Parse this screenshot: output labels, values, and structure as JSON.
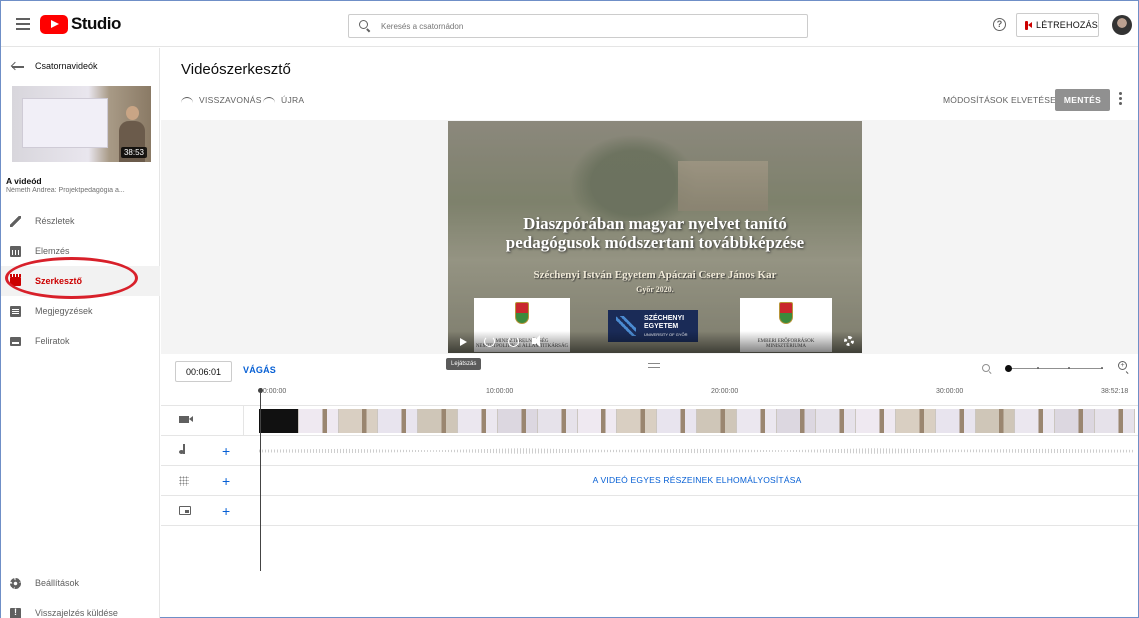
{
  "header": {
    "logo_text": "Studio",
    "search_placeholder": "Keresés a csatornádon",
    "help_icon": "?",
    "create_label": "LÉTREHOZÁS"
  },
  "sidebar": {
    "back_label": "Csatornavideók",
    "thumbnail_duration": "38:53",
    "your_video_label": "A videód",
    "video_subtitle": "Németh Andrea: Projektpedagógia a...",
    "items": [
      {
        "label": "Részletek",
        "icon": "pencil-icon"
      },
      {
        "label": "Elemzés",
        "icon": "analytics-icon"
      },
      {
        "label": "Szerkesztő",
        "icon": "editor-icon"
      },
      {
        "label": "Megjegyzések",
        "icon": "comments-icon"
      },
      {
        "label": "Feliratok",
        "icon": "subtitles-icon"
      }
    ],
    "bottom_items": [
      {
        "label": "Beállítások",
        "icon": "settings-icon"
      },
      {
        "label": "Visszajelzés küldése",
        "icon": "feedback-icon"
      }
    ],
    "active_index": 2
  },
  "editor": {
    "title": "Videószerkesztő",
    "undo_label": "VISSZAVONÁS",
    "redo_label": "ÚJRA",
    "discard_label": "MÓDOSÍTÁSOK ELVETÉSE",
    "save_label": "MENTÉS"
  },
  "video": {
    "title_line1": "Diaszpórában magyar nyelvet tanító",
    "title_line2": "pedagógusok módszertani továbbképzése",
    "subtitle": "Széchenyi István Egyetem Apáczai Csere János Kar",
    "year": "Győr 2020.",
    "left_badge": "MINISZTERELNÖKSÉG NEMZETPOLITIKAI ÁLLAMTITKÁRSÁG",
    "center_badge_line1": "SZÉCHENYI",
    "center_badge_line2": "EGYETEM",
    "center_badge_line3": "UNIVERSITY OF GYŐR",
    "right_badge": "EMBERI ERŐFORRÁSOK MINISZTÉRIUMA",
    "tooltip": "Lejátszás"
  },
  "timeline": {
    "timecode": "00:06:01",
    "cut_label": "VÁGÁS",
    "ticks": [
      "00:00:00",
      "10:00:00",
      "20:00:00",
      "30:00:00",
      "38:52:18"
    ],
    "blur_label": "A VIDEÓ EGYES RÉSZEINEK ELHOMÁLYOSÍTÁSA",
    "add_symbol": "+",
    "zoom_level": 0
  }
}
